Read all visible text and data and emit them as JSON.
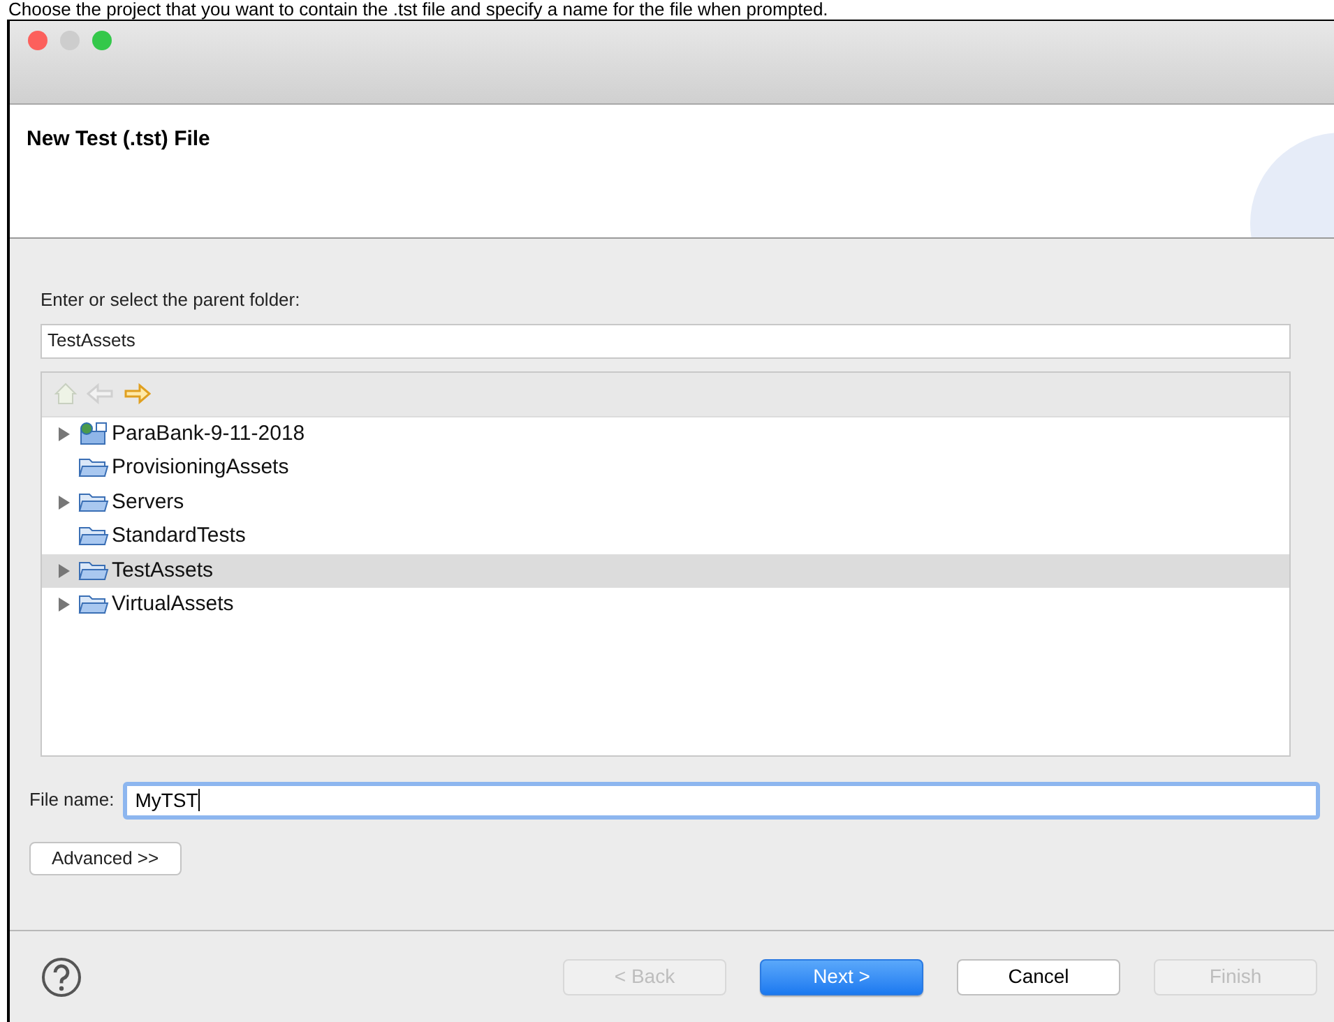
{
  "caption": "Choose the project that you want to contain the .tst file and specify a name for the file when prompted.",
  "window_controls": [
    {
      "color": "#fc605c"
    },
    {
      "color": "#cdcdcd"
    },
    {
      "color": "#34c84a"
    }
  ],
  "header": {
    "title": "New Test (.tst) File"
  },
  "parent_folder": {
    "label": "Enter or select the parent folder:",
    "value": "TestAssets"
  },
  "tree_toolbar": [
    {
      "kind": "home",
      "disabled": true
    },
    {
      "kind": "back",
      "disabled": true
    },
    {
      "kind": "forward",
      "disabled": false
    }
  ],
  "tree": [
    {
      "label": "ParaBank-9-11-2018",
      "kind": "project",
      "has_children": true,
      "selected": false
    },
    {
      "label": "ProvisioningAssets",
      "kind": "folder",
      "has_children": false,
      "selected": false
    },
    {
      "label": "Servers",
      "kind": "folder",
      "has_children": true,
      "selected": false
    },
    {
      "label": "StandardTests",
      "kind": "folder",
      "has_children": false,
      "selected": false
    },
    {
      "label": "TestAssets",
      "kind": "folder",
      "has_children": true,
      "selected": true
    },
    {
      "label": "VirtualAssets",
      "kind": "folder",
      "has_children": true,
      "selected": false
    }
  ],
  "file_name": {
    "label": "File name:",
    "value": "MyTST"
  },
  "advanced_button": "Advanced >>",
  "footer_buttons": [
    {
      "label": "< Back",
      "disabled": true,
      "default": false
    },
    {
      "label": "Next >",
      "disabled": false,
      "default": true
    },
    {
      "label": "Cancel",
      "disabled": false,
      "default": false
    },
    {
      "label": "Finish",
      "disabled": true,
      "default": false
    }
  ]
}
